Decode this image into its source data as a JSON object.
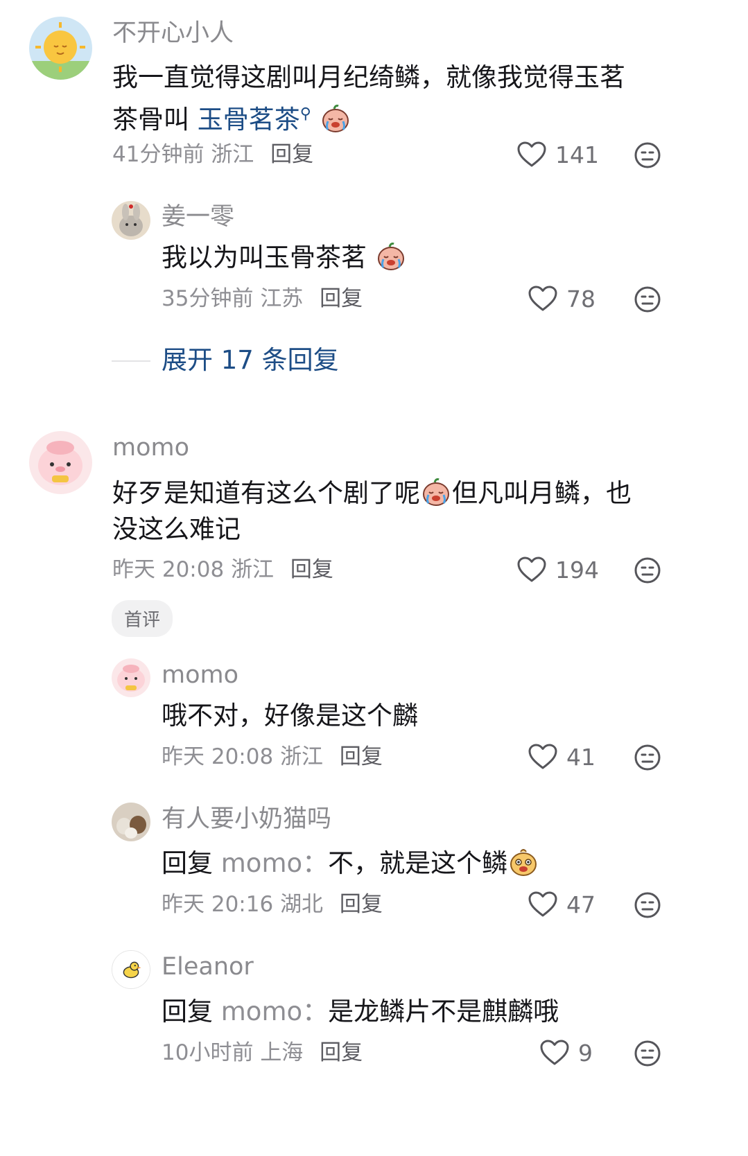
{
  "comments": [
    {
      "user": "不开心小人",
      "text_main": "我一直觉得这剧叫月纪绮鳞，就像我觉得玉茗",
      "text_line2_prefix": "茶骨叫",
      "text_link": "玉骨茗茶",
      "time": "41分钟前",
      "location": "浙江",
      "reply_label": "回复",
      "likes": "141"
    },
    {
      "user": "姜一零",
      "text": "我以为叫玉骨茶茗",
      "time": "35分钟前",
      "location": "江苏",
      "reply_label": "回复",
      "likes": "78"
    },
    {
      "user": "momo",
      "text_line1": "好歹是知道有这么个剧了呢",
      "text_line1_suffix": "但凡叫月鳞，也",
      "text_line2": "没这么难记",
      "time": "昨天 20:08",
      "location": "浙江",
      "reply_label": "回复",
      "likes": "194",
      "badge": "首评"
    },
    {
      "user": "momo",
      "text": "哦不对，好像是这个麟",
      "time": "昨天 20:08",
      "location": "浙江",
      "reply_label": "回复",
      "likes": "41"
    },
    {
      "user": "有人要小奶猫吗",
      "reply_prefix": "回复",
      "mention": "momo：",
      "text": "不，就是这个鳞",
      "time": "昨天 20:16",
      "location": "湖北",
      "reply_label": "回复",
      "likes": "47"
    },
    {
      "user": "Eleanor",
      "reply_prefix": "回复",
      "mention": "momo：",
      "text": "是龙鳞片不是麒麟哦",
      "time": "10小时前",
      "location": "上海",
      "reply_label": "回复",
      "likes": "9"
    }
  ],
  "expand_replies": "展开 17 条回复",
  "icons": {
    "like": "heart-outline-icon",
    "dislike": "neutral-face-icon",
    "search": "search-icon"
  },
  "colors": {
    "link": "#1d4d86",
    "meta": "#8e8e93"
  }
}
